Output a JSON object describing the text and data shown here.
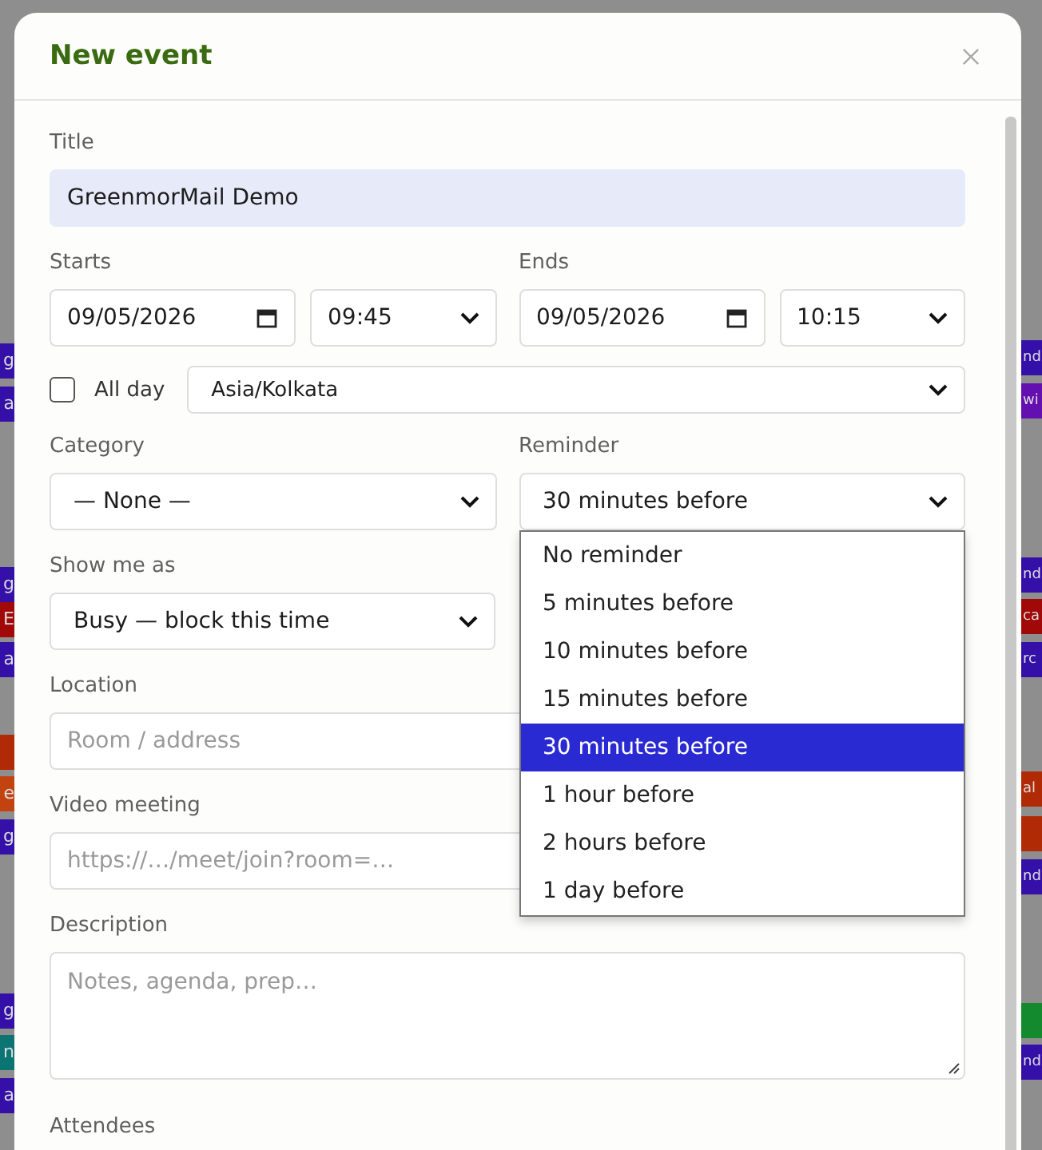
{
  "backdrop": {
    "left_events": [
      {
        "text": "g",
        "color": "#3510a8"
      },
      {
        "text": "a",
        "color": "#3510a8"
      },
      {
        "text": "g",
        "color": "#3510a8"
      },
      {
        "text": "E",
        "color": "#a10808"
      },
      {
        "text": "a",
        "color": "#3510a8"
      },
      {
        "color": "#b12a06"
      },
      {
        "text": "e",
        "color": "#c2430f"
      },
      {
        "text": "g",
        "color": "#3510a8"
      },
      {
        "text": "g",
        "color": "#3510a8"
      },
      {
        "text": "n",
        "color": "#0d7474"
      },
      {
        "text": "a",
        "color": "#3510a8"
      }
    ],
    "right_events": [
      {
        "text": "nd",
        "color": "#3510a8"
      },
      {
        "text": "wi",
        "color": "#6410b0"
      },
      {
        "text": "nd",
        "color": "#3510a8"
      },
      {
        "text": "ca",
        "color": "#a10808"
      },
      {
        "text": "rc",
        "color": "#3510a8"
      },
      {
        "text": "al",
        "color": "#b12a06"
      },
      {
        "color": "#b12a06"
      },
      {
        "text": "nd",
        "color": "#3510a8"
      },
      {
        "color": "#148a2e"
      },
      {
        "text": "nd",
        "color": "#3510a8"
      }
    ]
  },
  "dialog": {
    "title": "New event",
    "title_field": {
      "label": "Title",
      "value": "GreenmorMail Demo"
    },
    "starts": {
      "label": "Starts",
      "date": "09/05/2026",
      "time": "09:45"
    },
    "ends": {
      "label": "Ends",
      "date": "09/05/2026",
      "time": "10:15"
    },
    "all_day": {
      "label": "All day",
      "checked": false
    },
    "timezone": {
      "value": "Asia/Kolkata"
    },
    "category": {
      "label": "Category",
      "value": "— None —"
    },
    "reminder": {
      "label": "Reminder",
      "value": "30 minutes before",
      "expanded": true,
      "options": [
        {
          "label": "No reminder",
          "selected": false
        },
        {
          "label": "5 minutes before",
          "selected": false
        },
        {
          "label": "10 minutes before",
          "selected": false
        },
        {
          "label": "15 minutes before",
          "selected": false
        },
        {
          "label": "30 minutes before",
          "selected": true
        },
        {
          "label": "1 hour before",
          "selected": false
        },
        {
          "label": "2 hours before",
          "selected": false
        },
        {
          "label": "1 day before",
          "selected": false
        }
      ]
    },
    "show_as": {
      "label": "Show me as",
      "value": "Busy — block this time"
    },
    "location": {
      "label": "Location",
      "placeholder": "Room / address"
    },
    "video_meeting": {
      "label": "Video meeting",
      "placeholder": "https://…/meet/join?room=…"
    },
    "description": {
      "label": "Description",
      "placeholder": "Notes, agenda, prep…"
    },
    "attendees": {
      "label": "Attendees"
    }
  }
}
